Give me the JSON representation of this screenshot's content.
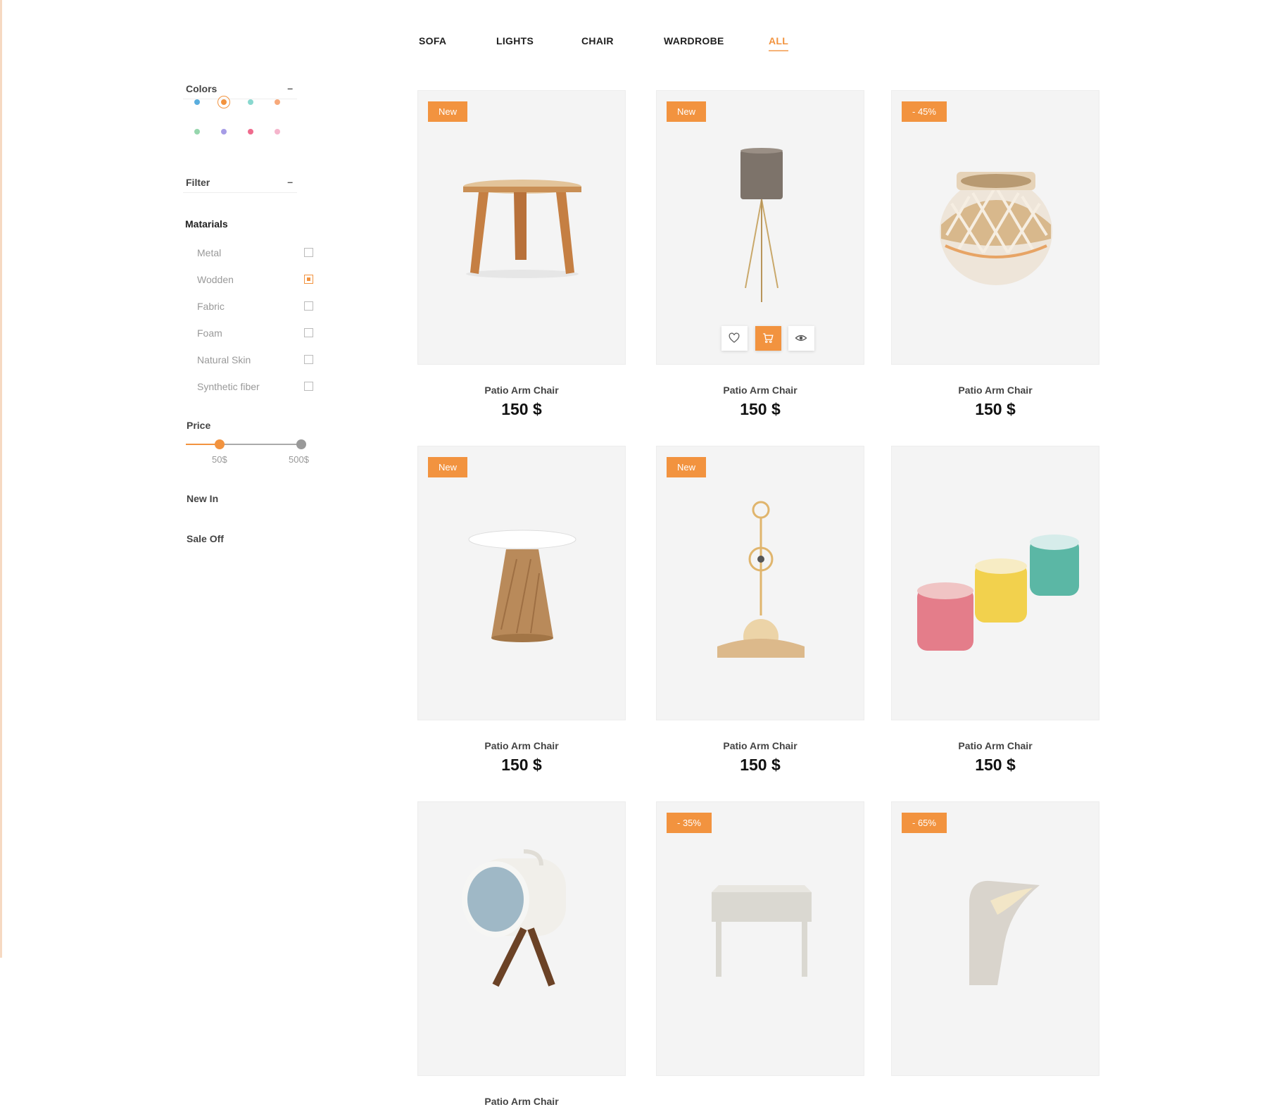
{
  "nav": {
    "items": [
      {
        "label": "SOFA"
      },
      {
        "label": "LIGHTS"
      },
      {
        "label": "CHAIR"
      },
      {
        "label": "WARDROBE"
      },
      {
        "label": "ALL",
        "active": true
      }
    ]
  },
  "sidebar": {
    "colors": {
      "title": "Colors",
      "toggle": "–",
      "swatches": [
        "#5aaede",
        "#f2933f",
        "#89d8cf",
        "#f7a97b",
        "#96d6ad",
        "#a69ce6",
        "#ef6b8d",
        "#f5b5cc"
      ],
      "selected_index": 1
    },
    "filter": {
      "title": "Filter",
      "toggle": "–"
    },
    "materials": {
      "title": "Matarials",
      "items": [
        {
          "label": "Metal",
          "checked": false
        },
        {
          "label": "Wodden",
          "checked": true
        },
        {
          "label": "Fabric",
          "checked": false
        },
        {
          "label": "Foam",
          "checked": false
        },
        {
          "label": "Natural Skin",
          "checked": false
        },
        {
          "label": "Synthetic fiber",
          "checked": false
        }
      ]
    },
    "price": {
      "title": "Price",
      "min_label": "50$",
      "max_label": "500$",
      "range_min_fraction": 0.29,
      "range_max_fraction": 1.0
    },
    "links": {
      "new_in": "New In",
      "sale_off": "Sale Off"
    }
  },
  "products": [
    {
      "badge": "New",
      "name": "Patio Arm Chair",
      "price": "150 $",
      "image": "wooden-stool"
    },
    {
      "badge": "New",
      "name": "Patio Arm Chair",
      "price": "150 $",
      "image": "floor-lamp",
      "hover_actions": true
    },
    {
      "badge": "- 45%",
      "name": "Patio Arm Chair",
      "price": "150 $",
      "image": "wicker-lantern"
    },
    {
      "badge": "New",
      "name": "Patio Arm Chair",
      "price": "150 $",
      "image": "side-table"
    },
    {
      "badge": "New",
      "name": "Patio Arm Chair",
      "price": "150 $",
      "image": "table-clock-lamp"
    },
    {
      "badge": "",
      "name": "Patio Arm Chair",
      "price": "150 $",
      "image": "candles"
    },
    {
      "badge": "",
      "name": "Patio Arm Chair",
      "price": "",
      "image": "spot-lamp"
    },
    {
      "badge": "- 35%",
      "name": "",
      "price": "",
      "image": "nightstand"
    },
    {
      "badge": "- 65%",
      "name": "",
      "price": "",
      "image": "desk-lamp"
    }
  ],
  "colors": {
    "accent": "#f2933f",
    "card_bg": "#f4f4f4"
  }
}
